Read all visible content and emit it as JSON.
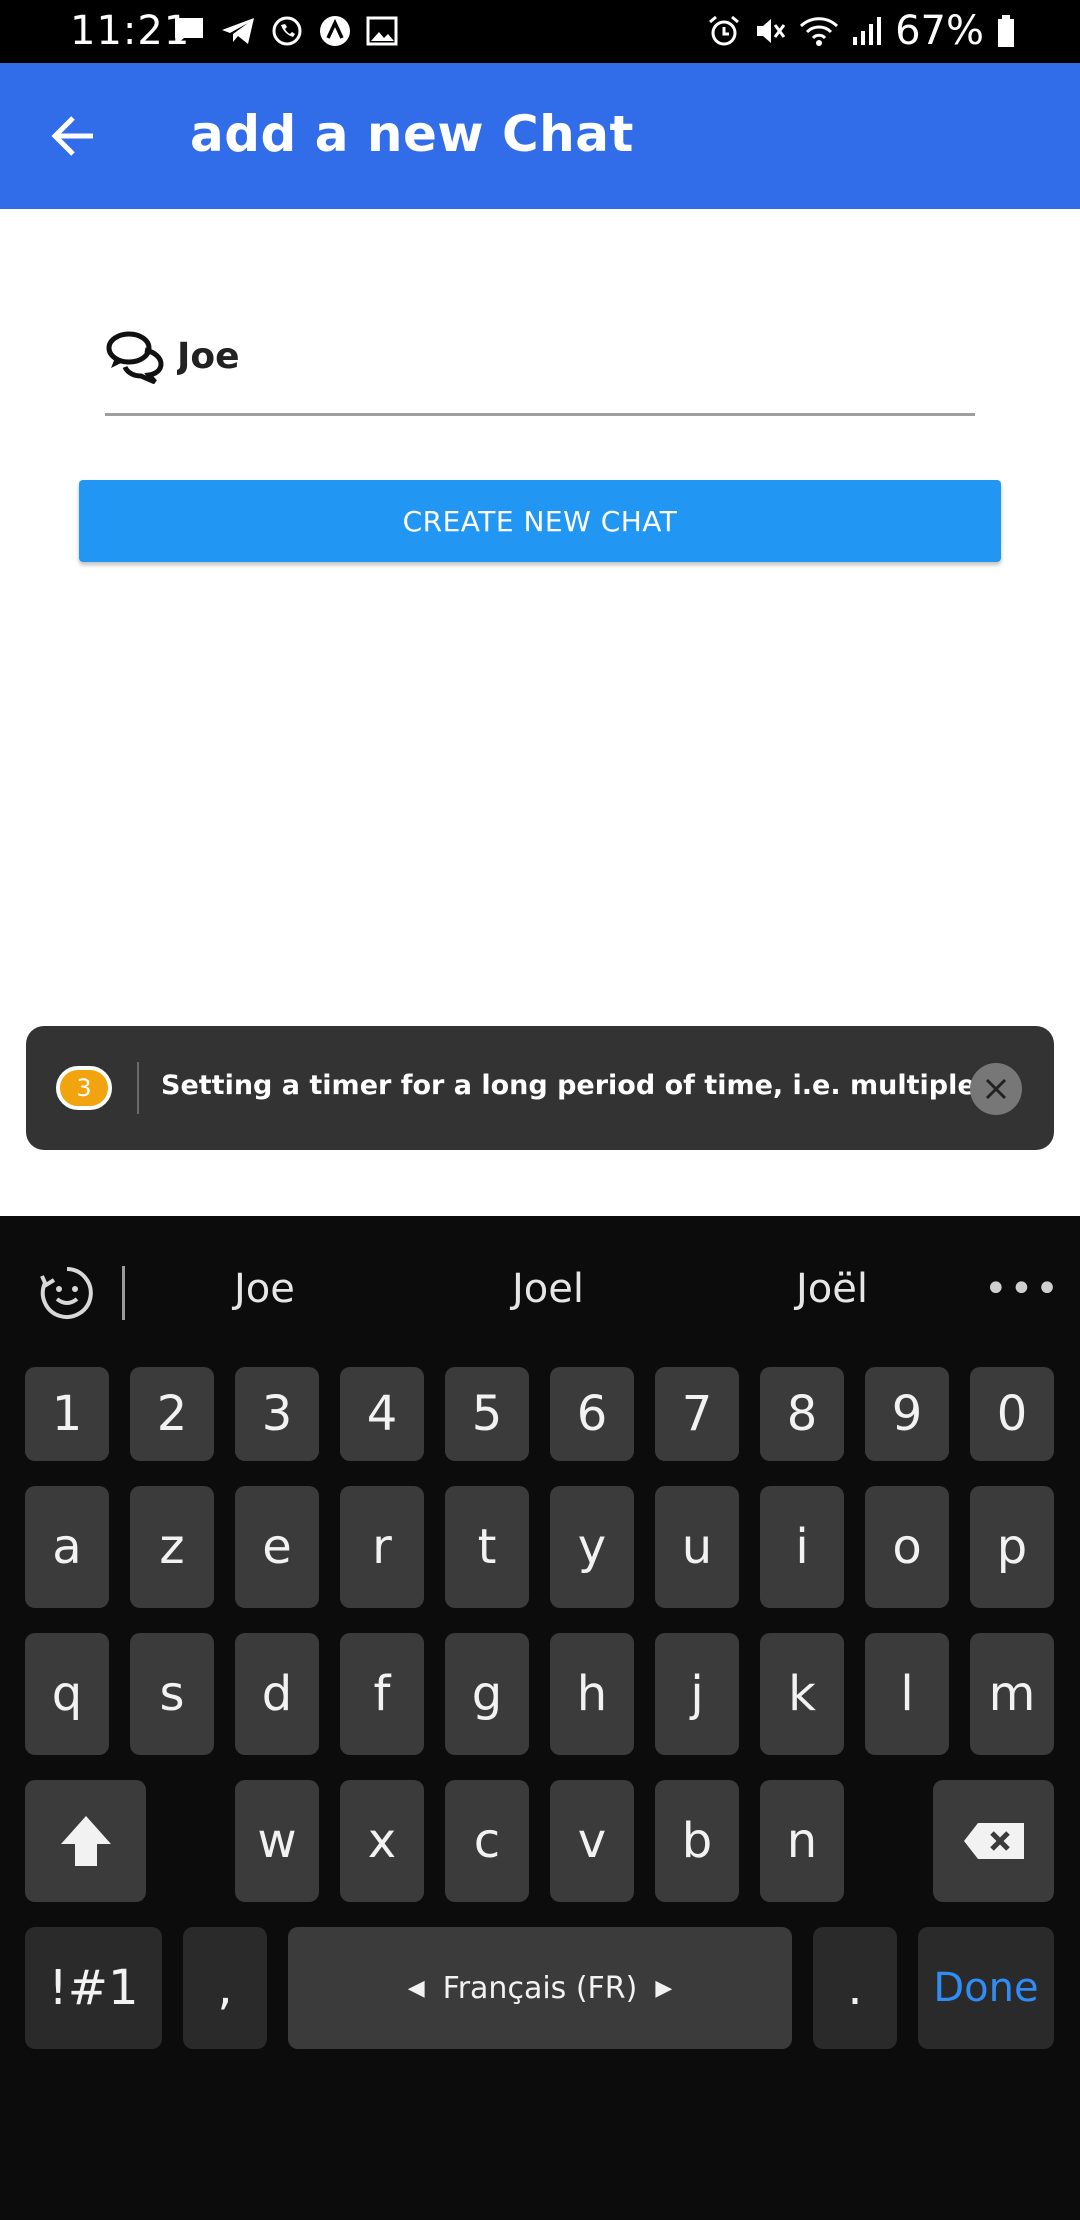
{
  "status_bar": {
    "time": "11:21",
    "battery": "67%",
    "left_icons": [
      "message-icon",
      "telegram-icon",
      "whatsapp-icon",
      "app-icon",
      "image-icon"
    ],
    "right_icons": [
      "alarm-icon",
      "mute-icon",
      "wifi-icon",
      "signal-icon",
      "battery-icon"
    ]
  },
  "app_bar": {
    "title": "add a new Chat",
    "color": "#316de9"
  },
  "form": {
    "chat_name_value": "Joe",
    "create_button_label": "CREATE NEW CHAT",
    "button_color": "#2196f3"
  },
  "toast": {
    "badge": "3",
    "message": "Setting a timer for a long period of time, i.e. multiple minutes..."
  },
  "keyboard": {
    "suggestions": [
      "Joe",
      "Joel",
      "Joël"
    ],
    "more": "•••",
    "row_numbers": [
      "1",
      "2",
      "3",
      "4",
      "5",
      "6",
      "7",
      "8",
      "9",
      "0"
    ],
    "row1": [
      "a",
      "z",
      "e",
      "r",
      "t",
      "y",
      "u",
      "i",
      "o",
      "p"
    ],
    "row2": [
      "q",
      "s",
      "d",
      "f",
      "g",
      "h",
      "j",
      "k",
      "l",
      "m"
    ],
    "row3": [
      "w",
      "x",
      "c",
      "v",
      "b",
      "n"
    ],
    "symbols_label": "!#1",
    "comma": ",",
    "space_label": "Français (FR)",
    "period": ".",
    "done_label": "Done"
  }
}
